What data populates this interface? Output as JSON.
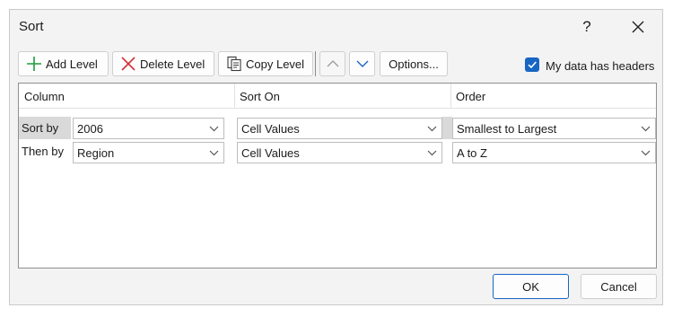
{
  "window": {
    "title": "Sort",
    "help_label": "?",
    "close_label": "✕"
  },
  "toolbar": {
    "add_level": "Add Level",
    "delete_level": "Delete Level",
    "copy_level": "Copy Level",
    "options": "Options...",
    "move_up_icon": "chevron-up-icon",
    "move_down_icon": "chevron-down-icon"
  },
  "headers_checkbox": {
    "label": "My data has headers",
    "checked": true
  },
  "grid": {
    "columns": [
      "Column",
      "Sort On",
      "Order"
    ],
    "rows": [
      {
        "label": "Sort by",
        "column": "2006",
        "sort_on": "Cell Values",
        "order": "Smallest to Largest",
        "selected": true
      },
      {
        "label": "Then by",
        "column": "Region",
        "sort_on": "Cell Values",
        "order": "A to Z",
        "selected": false
      }
    ]
  },
  "buttons": {
    "ok": "OK",
    "cancel": "Cancel"
  },
  "colors": {
    "accent": "#1866c4",
    "add_icon": "#1e9b3a",
    "delete_icon": "#d13438",
    "dialog_bg": "#f3f3f3"
  }
}
